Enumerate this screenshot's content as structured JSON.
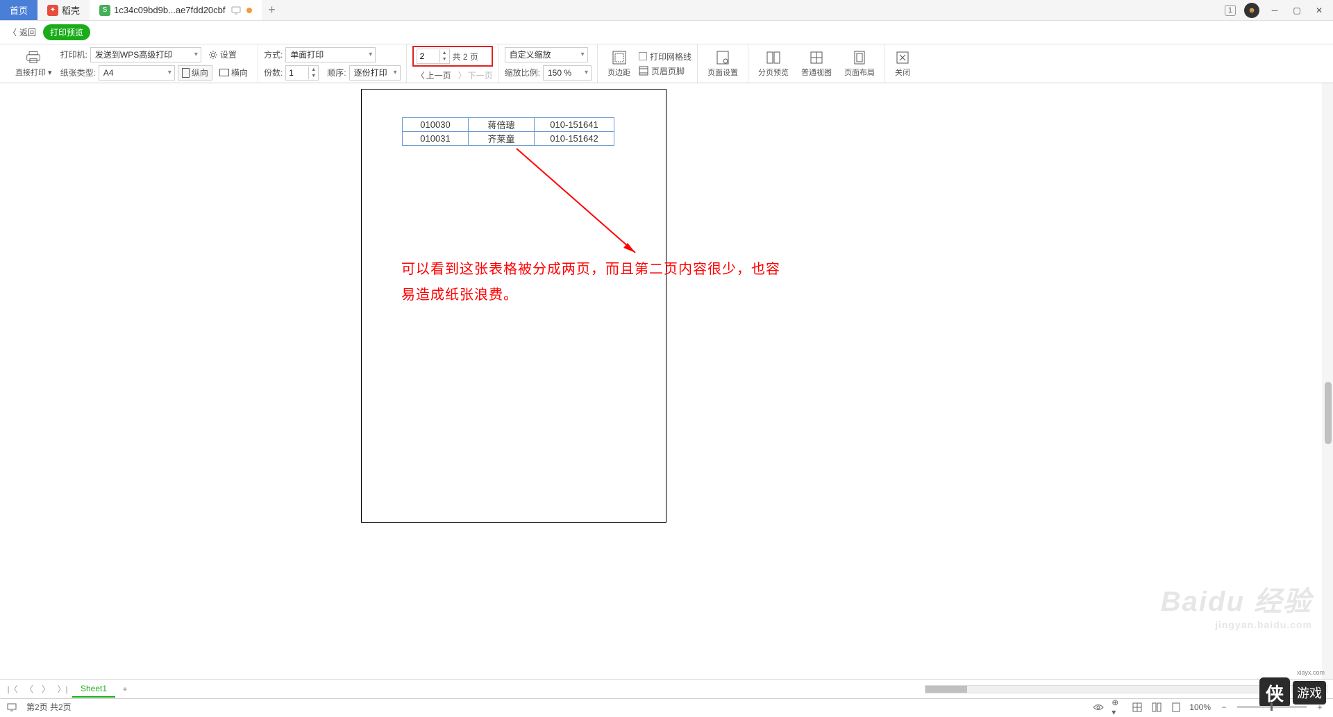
{
  "tabs": {
    "home": "首页",
    "daoke": "稻壳",
    "file": "1c34c09bd9b...ae7fdd20cbf"
  },
  "titlebar": {
    "badge": "1"
  },
  "returnbar": {
    "back": "返回",
    "preview": "打印预览"
  },
  "toolbar": {
    "direct_print": "直接打印",
    "printer_label": "打印机:",
    "printer_value": "发送到WPS高级打印",
    "settings": "设置",
    "paper_type_label": "纸张类型:",
    "paper_type_value": "A4",
    "portrait": "纵向",
    "landscape": "横向",
    "mode_label": "方式:",
    "mode_value": "单面打印",
    "copies_label": "份数:",
    "copies_value": "1",
    "order_label": "顺序:",
    "order_value": "逐份打印",
    "page_current": "2",
    "page_total_label": "共 2 页",
    "prev_page": "上一页",
    "next_page": "下一页",
    "zoom_mode": "自定义缩放",
    "zoom_ratio_label": "缩放比例:",
    "zoom_ratio_value": "150 %",
    "margins": "页边距",
    "print_gridlines": "打印网格线",
    "header_footer": "页眉页脚",
    "page_setup": "页面设置",
    "page_break_preview": "分页预览",
    "normal_view": "普通视图",
    "page_layout": "页面布局",
    "close": "关闭"
  },
  "table": {
    "rows": [
      {
        "c1": "010030",
        "c2": "蒋倍璁",
        "c3": "010-151641"
      },
      {
        "c1": "010031",
        "c2": "齐莱童",
        "c3": "010-151642"
      }
    ]
  },
  "annotation": {
    "line1": "可以看到这张表格被分成两页，而且第二页内容很少，也容",
    "line2": "易造成纸张浪费。"
  },
  "sheets": {
    "sheet1": "Sheet1"
  },
  "statusbar": {
    "page_info": "第2页 共2页",
    "zoom": "100%"
  },
  "watermarks": {
    "baidu": "Baidu 经验",
    "baidu_url": "jingyan.baidu.com",
    "xia_logo": "侠",
    "xia_text": "游戏",
    "xia_url": "xiayx.com"
  }
}
